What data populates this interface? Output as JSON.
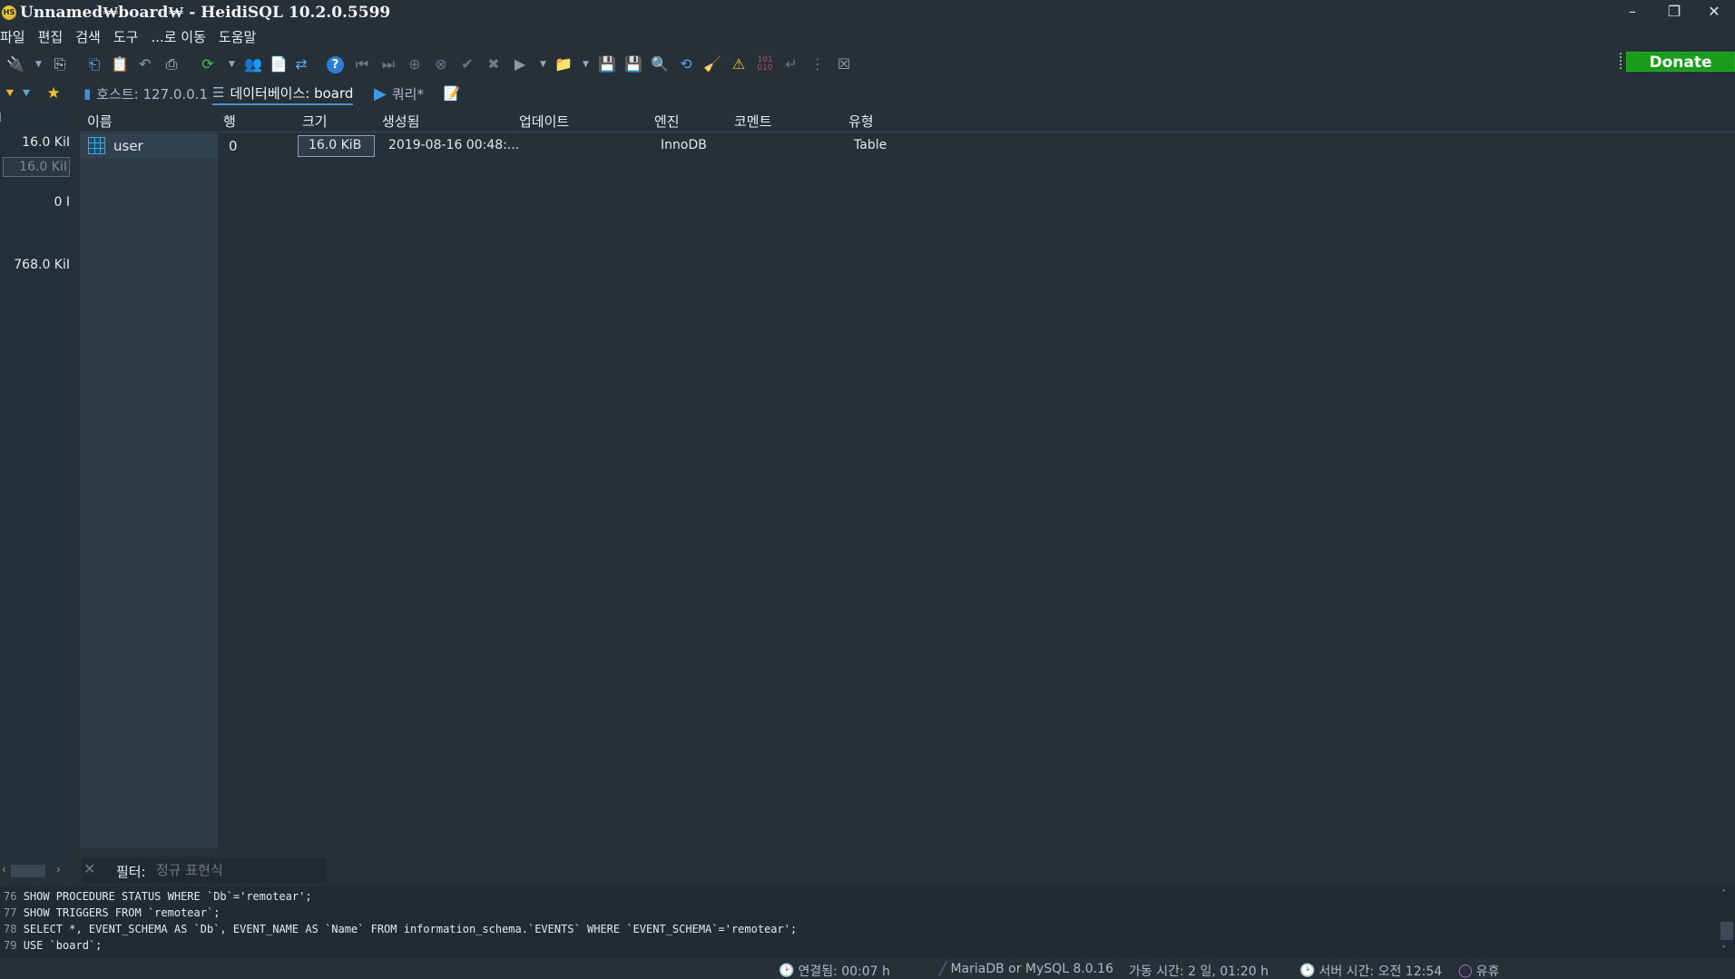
{
  "window": {
    "title": "Unnamed₩board₩ - HeidiSQL 10.2.0.5599",
    "app_icon": "HS",
    "minimize": "–",
    "restore": "❐",
    "close": "✕"
  },
  "menu": [
    "파일",
    "편집",
    "검색",
    "도구",
    "...로 이동",
    "도움말"
  ],
  "toolbar": {
    "donate_label": "Donate"
  },
  "tabs": {
    "host": "호스트: 127.0.0.1",
    "database": "데이터베이스: board",
    "query": "쿼리*"
  },
  "left_panel": {
    "values": [
      "16.0 KiI",
      "16.0 KiI",
      "0 I",
      "768.0 KiI"
    ]
  },
  "grid": {
    "columns": [
      "이름",
      "행",
      "크기",
      "생성됨",
      "업데이트",
      "엔진",
      "코멘트",
      "유형"
    ],
    "rows": [
      {
        "name": "user",
        "rows": "0",
        "size": "16.0 KiB",
        "created": "2019-08-16 00:48:...",
        "updated": "",
        "engine": "InnoDB",
        "comment": "",
        "type": "Table"
      }
    ]
  },
  "filter": {
    "label": "필터:",
    "placeholder": "정규 표현식",
    "value": ""
  },
  "log": {
    "lines": [
      {
        "n": "76",
        "text": "SHOW PROCEDURE STATUS WHERE `Db`='remotear';"
      },
      {
        "n": "77",
        "text": "SHOW TRIGGERS FROM `remotear`;"
      },
      {
        "n": "78",
        "text": "SELECT *, EVENT_SCHEMA AS `Db`, EVENT_NAME AS `Name` FROM information_schema.`EVENTS` WHERE `EVENT_SCHEMA`='remotear';"
      },
      {
        "n": "79",
        "text": "USE `board`;"
      }
    ]
  },
  "status": {
    "connected": "연결됨: 00:07 h",
    "server_version": "MariaDB or MySQL 8.0.16",
    "uptime": "가동 시간: 2 일, 01:20 h",
    "server_time": "서버 시간: 오전 12:54",
    "state": "유휴"
  },
  "colors": {
    "background": "#263039",
    "donate": "#1a9b1a",
    "accent": "#4a8fd4"
  }
}
